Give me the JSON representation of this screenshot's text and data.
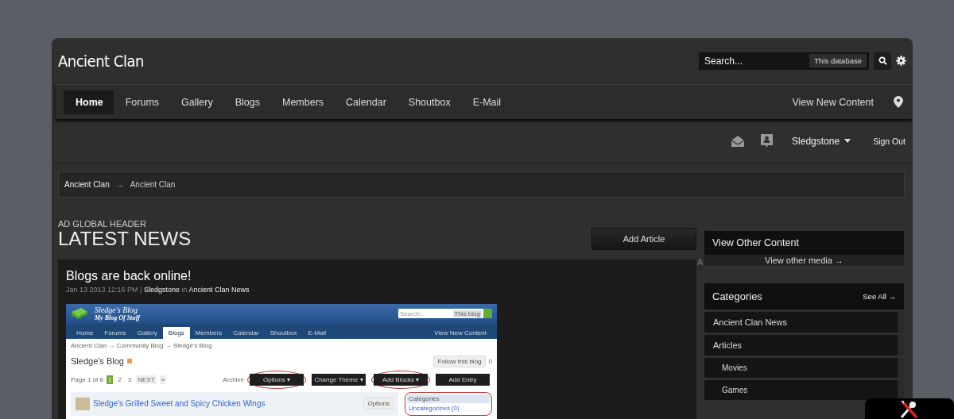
{
  "site_title": "Ancient Clan",
  "search": {
    "placeholder": "Search...",
    "scope": "This database"
  },
  "nav": [
    {
      "label": "Home",
      "selected": true
    },
    {
      "label": "Forums",
      "selected": false
    },
    {
      "label": "Gallery",
      "selected": false
    },
    {
      "label": "Blogs",
      "selected": false
    },
    {
      "label": "Members",
      "selected": false
    },
    {
      "label": "Calendar",
      "selected": false
    },
    {
      "label": "Shoutbox",
      "selected": false
    },
    {
      "label": "E-Mail",
      "selected": false
    }
  ],
  "view_new_content": "View New Content",
  "user_bar": {
    "username": "Sledgstone",
    "sign_out": "Sign Out"
  },
  "breadcrumb": [
    "Ancient Clan",
    "Ancient Clan"
  ],
  "breadcrumb_separator": "→",
  "ad_header": "AD GLOBAL HEADER",
  "page_title": "LATEST NEWS",
  "add_article": "Add Article",
  "ad_label_cut": "A",
  "article": {
    "title": "Blogs are back online!",
    "date": "Jan 13 2013 12:16 PM",
    "separator": "|",
    "author": "Sledgstone",
    "in": "in",
    "category": "Ancient Clan News",
    "shot": {
      "blog_title": "Sledge's Blog",
      "tagline": "My Blog Of Stuff",
      "search_placeholder": "Search...",
      "search_scope": "This blog",
      "nav": [
        {
          "label": "Home",
          "selected": false
        },
        {
          "label": "Forums",
          "selected": false
        },
        {
          "label": "Gallery",
          "selected": false
        },
        {
          "label": "Blogs",
          "selected": true
        },
        {
          "label": "Members",
          "selected": false
        },
        {
          "label": "Calendar",
          "selected": false
        },
        {
          "label": "Shoutbox",
          "selected": false
        },
        {
          "label": "E-Mail",
          "selected": false
        }
      ],
      "view_new_content": "View New Content",
      "breadcrumb": "Ancient Clan → Community Blog → Sledge's Blog",
      "heading": "Sledge's Blog",
      "follow": "Follow this blog",
      "followers": "0",
      "pages_label": "Page 1 of 8",
      "pages": [
        {
          "label": "1",
          "selected": true
        },
        {
          "label": "2",
          "selected": false
        },
        {
          "label": "3",
          "selected": false
        }
      ],
      "next": "NEXT",
      "last": "»",
      "archive": "Archive",
      "buttons": [
        {
          "label": "Options ▾",
          "circled": true
        },
        {
          "label": "Change Theme ▾",
          "circled": false
        },
        {
          "label": "Add Blocks ▾",
          "circled": true
        },
        {
          "label": "Add Entry",
          "circled": false
        }
      ],
      "entry_title": "Sledge's Grilled Sweet and Spicy Chicken Wings",
      "entry_options": "Options",
      "categories_title": "Categories",
      "category_item": "Uncategorized (0)"
    }
  },
  "other_content": {
    "title": "View Other Content",
    "link": "View other media →"
  },
  "categories": {
    "title": "Categories",
    "see_all": "See All →",
    "items": [
      {
        "label": "Ancient Clan News"
      },
      {
        "label": "Articles",
        "children": [
          {
            "label": "Movies"
          },
          {
            "label": "Games"
          }
        ]
      }
    ]
  }
}
